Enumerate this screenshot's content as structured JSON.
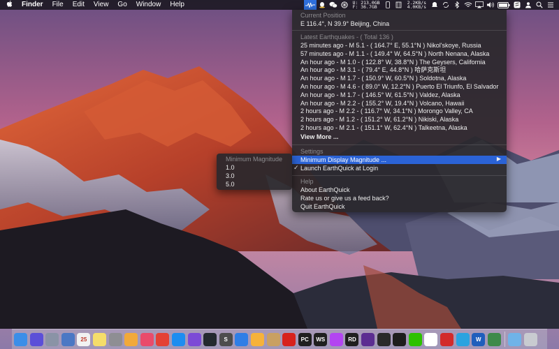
{
  "menubar": {
    "apple_icon": "apple-icon",
    "items": [
      "Finder",
      "File",
      "Edit",
      "View",
      "Go",
      "Window",
      "Help"
    ],
    "net_up": "U: 213.0GB",
    "net_down": "F:  36.7GB",
    "speed_up": "2.2KB/s",
    "speed_down": "4.0KB/s"
  },
  "dropdown": {
    "current_position_title": "Current Position",
    "current_position": "E 116.4°, N 39.9° Beijing, China",
    "latest_title": "Latest Earthquakes - ( Total 136 )",
    "quakes": [
      "25 minutes ago - M 5.1 - ( 164.7° E, 55.1°N ) Nikol'skoye, Russia",
      "57 minutes ago - M 1.1 - ( 149.4° W, 64.5°N ) North Nenana, Alaska",
      "An hour ago - M 1.0 - ( 122.8° W, 38.8°N ) The Geysers, California",
      "An hour ago - M 3.1 - ( 79.4° E, 44.8°N ) 哈萨克斯坦",
      "An hour ago - M 1.7 - ( 150.9° W, 60.5°N ) Soldotna, Alaska",
      "An hour ago - M 4.6 - ( 89.0° W, 12.2°N ) Puerto El Triunfo, El Salvador",
      "An hour ago - M 1.7 - ( 146.5° W, 61.5°N ) Valdez, Alaska",
      "An hour ago - M 2.2 - ( 155.2° W, 19.4°N ) Volcano, Hawaii",
      "2 hours ago - M 2.2 - ( 116.7° W, 34.1°N ) Morongo Valley, CA",
      "2 hours ago - M 1.2 - ( 151.2° W, 61.2°N ) Nikiski, Alaska",
      "2 hours ago - M 2.1 - ( 151.1° W, 62.4°N ) Talkeetna, Alaska"
    ],
    "view_more": "View More ...",
    "settings_title": "Settings",
    "min_magnitude": "Minimum Display Magnitude ...",
    "launch_login": "Launch EarthQuick at Login",
    "launch_checked": "✓",
    "help_title": "Help",
    "about": "About EarthQuick",
    "rate": "Rate us or give us a feed back?",
    "quit": "Quit EarthQuick"
  },
  "submenu": {
    "title": "Minimum Magnitude",
    "options": [
      "1.0",
      "3.0",
      "5.0"
    ]
  },
  "dock": {
    "items": [
      {
        "name": "finder-icon",
        "color": "#3b8ee8",
        "glyph": ""
      },
      {
        "name": "siri-icon",
        "color": "#5b4fd8",
        "glyph": ""
      },
      {
        "name": "launchpad-icon",
        "color": "#8a93a6",
        "glyph": ""
      },
      {
        "name": "preview-icon",
        "color": "#4b78c4",
        "glyph": ""
      },
      {
        "name": "calendar-icon",
        "color": "#f2f2f2",
        "glyph": "25"
      },
      {
        "name": "notes-icon",
        "color": "#f5dd6a",
        "glyph": ""
      },
      {
        "name": "system-preferences-icon",
        "color": "#8e8e93",
        "glyph": ""
      },
      {
        "name": "photos-icon",
        "color": "#f1a93a",
        "glyph": ""
      },
      {
        "name": "music-icon",
        "color": "#e94b6b",
        "glyph": ""
      },
      {
        "name": "chrome-icon",
        "color": "#e44134",
        "glyph": ""
      },
      {
        "name": "app-store-icon",
        "color": "#1d8df0",
        "glyph": ""
      },
      {
        "name": "dash-icon",
        "color": "#7c4ad6",
        "glyph": ""
      },
      {
        "name": "github-icon",
        "color": "#24292e",
        "glyph": ""
      },
      {
        "name": "sublime-text-icon",
        "color": "#4d4d4d",
        "glyph": "S"
      },
      {
        "name": "xcode-icon",
        "color": "#2f7ee6",
        "glyph": ""
      },
      {
        "name": "sketch-icon",
        "color": "#f6b23a",
        "glyph": ""
      },
      {
        "name": "sequel-pro-icon",
        "color": "#c9a062",
        "glyph": ""
      },
      {
        "name": "netease-music-icon",
        "color": "#d7221c",
        "glyph": ""
      },
      {
        "name": "pycharm-icon",
        "color": "#1f1f1f",
        "glyph": "PC"
      },
      {
        "name": "webstorm-icon",
        "color": "#1f1f1f",
        "glyph": "WS"
      },
      {
        "name": "phpstorm-icon",
        "color": "#b345f1",
        "glyph": ""
      },
      {
        "name": "rider-icon",
        "color": "#1f1f1f",
        "glyph": "RD"
      },
      {
        "name": "visual-studio-icon",
        "color": "#5c2d91",
        "glyph": ""
      },
      {
        "name": "unity-icon",
        "color": "#2a2a2a",
        "glyph": ""
      },
      {
        "name": "terminal-icon",
        "color": "#1d1d1d",
        "glyph": ""
      },
      {
        "name": "wechat-icon",
        "color": "#2dc100",
        "glyph": ""
      },
      {
        "name": "qq-icon",
        "color": "#ffffff",
        "glyph": ""
      },
      {
        "name": "shield-app-icon",
        "color": "#d22b2b",
        "glyph": ""
      },
      {
        "name": "telegram-icon",
        "color": "#2aa3e0",
        "glyph": ""
      },
      {
        "name": "word-icon",
        "color": "#1f5ebc",
        "glyph": "W"
      },
      {
        "name": "android-studio-icon",
        "color": "#3d8a4b",
        "glyph": ""
      },
      {
        "name": "downloads-folder-icon",
        "color": "#6fb3e8",
        "glyph": ""
      },
      {
        "name": "trash-icon",
        "color": "#c8cbd0",
        "glyph": ""
      }
    ]
  }
}
